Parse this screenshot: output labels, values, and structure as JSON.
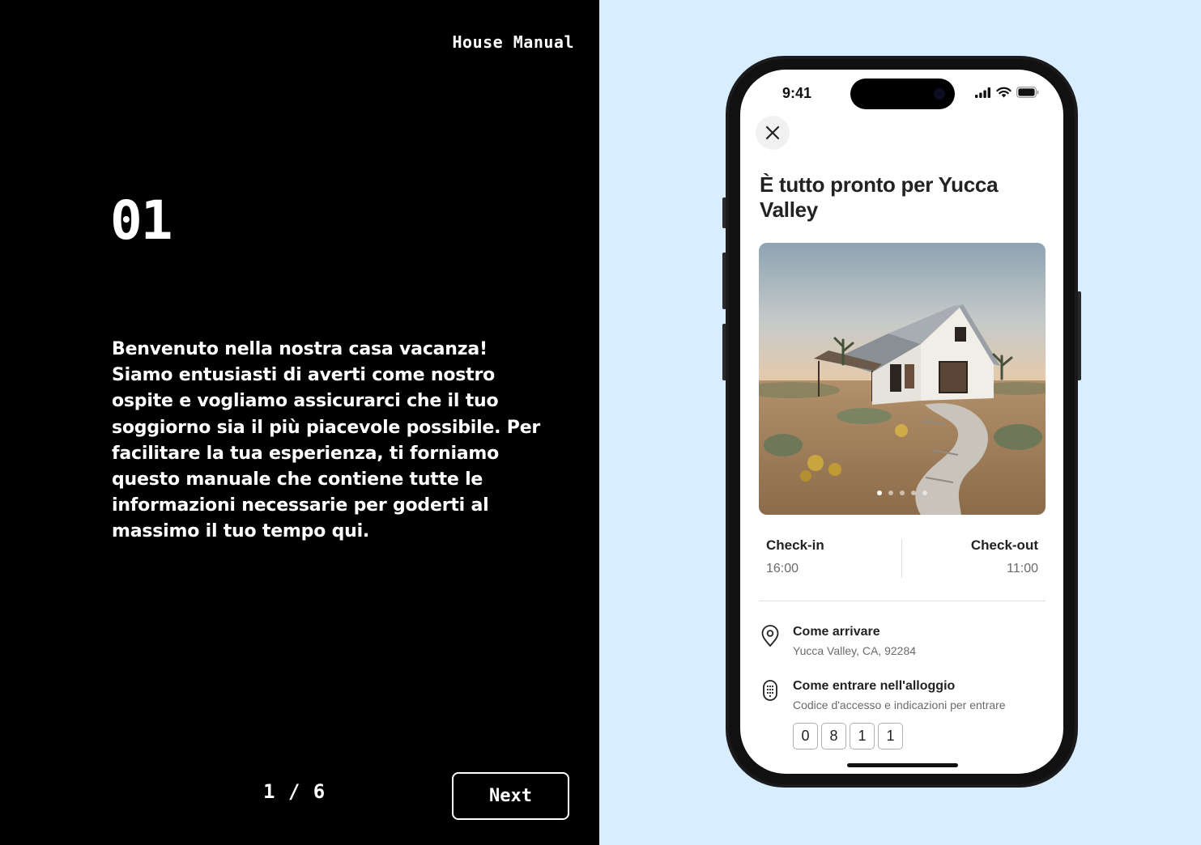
{
  "left": {
    "brand": "House Manual",
    "step_number": "01",
    "body": "Benvenuto nella nostra casa vacanza! Siamo entusiasti di averti come nostro ospite e vogliamo assicurarci che il tuo soggiorno sia il più piacevole possibile. Per facilitare la tua esperienza, ti forniamo questo manuale che contiene tutte le informazioni necessarie per goderti al massimo il tuo tempo qui.",
    "pager": "1 / 6",
    "next_label": "Next"
  },
  "phone": {
    "status_time": "9:41",
    "title": "È tutto pronto per Yucca Valley",
    "photo_dots": {
      "count": 5,
      "active": 1
    },
    "checkin": {
      "label": "Check-in",
      "time": "16:00"
    },
    "checkout": {
      "label": "Check-out",
      "time": "11:00"
    },
    "directions": {
      "title": "Come arrivare",
      "subtitle": "Yucca Valley, CA, 92284",
      "icon": "location-pin-icon"
    },
    "access": {
      "title": "Come entrare nell'alloggio",
      "subtitle": "Codice d'accesso e indicazioni per entrare",
      "icon": "keypad-icon",
      "code": [
        "0",
        "8",
        "1",
        "1"
      ]
    }
  },
  "colors": {
    "left_bg": "#000000",
    "right_bg": "#d8eefe",
    "text_light": "#ffffff"
  }
}
